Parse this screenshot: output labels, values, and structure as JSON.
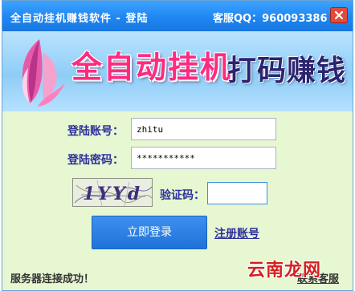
{
  "window": {
    "title": "全自动挂机赚钱软件 - 登陆",
    "customer_service": "客服QQ：960093386"
  },
  "banner": {
    "slogan_part1": "全自动挂机",
    "slogan_part2": "打码赚钱",
    "logo_icon": "flame-petal-logo"
  },
  "form": {
    "account_label": "登陆账号：",
    "account_value": "zhitu",
    "password_label": "登陆密码：",
    "password_value": "***********",
    "captcha_label": "验证码：",
    "captcha_value": "",
    "captcha_text": "1YYd",
    "login_button": "立即登录",
    "register_link": "注册账号"
  },
  "footer": {
    "status": "服务器连接成功！",
    "support_link": "联系客服"
  },
  "watermark": "云南龙网",
  "colors": {
    "titlebar": "#1f86f2",
    "window_bg": "#e6f7d2",
    "banner_bg": "#8fcdf6",
    "label": "#2d2f9a",
    "login_button": "#2a80e4",
    "watermark": "#d42020",
    "slogan1": "#ff2a80",
    "slogan2": "#2b246f"
  }
}
